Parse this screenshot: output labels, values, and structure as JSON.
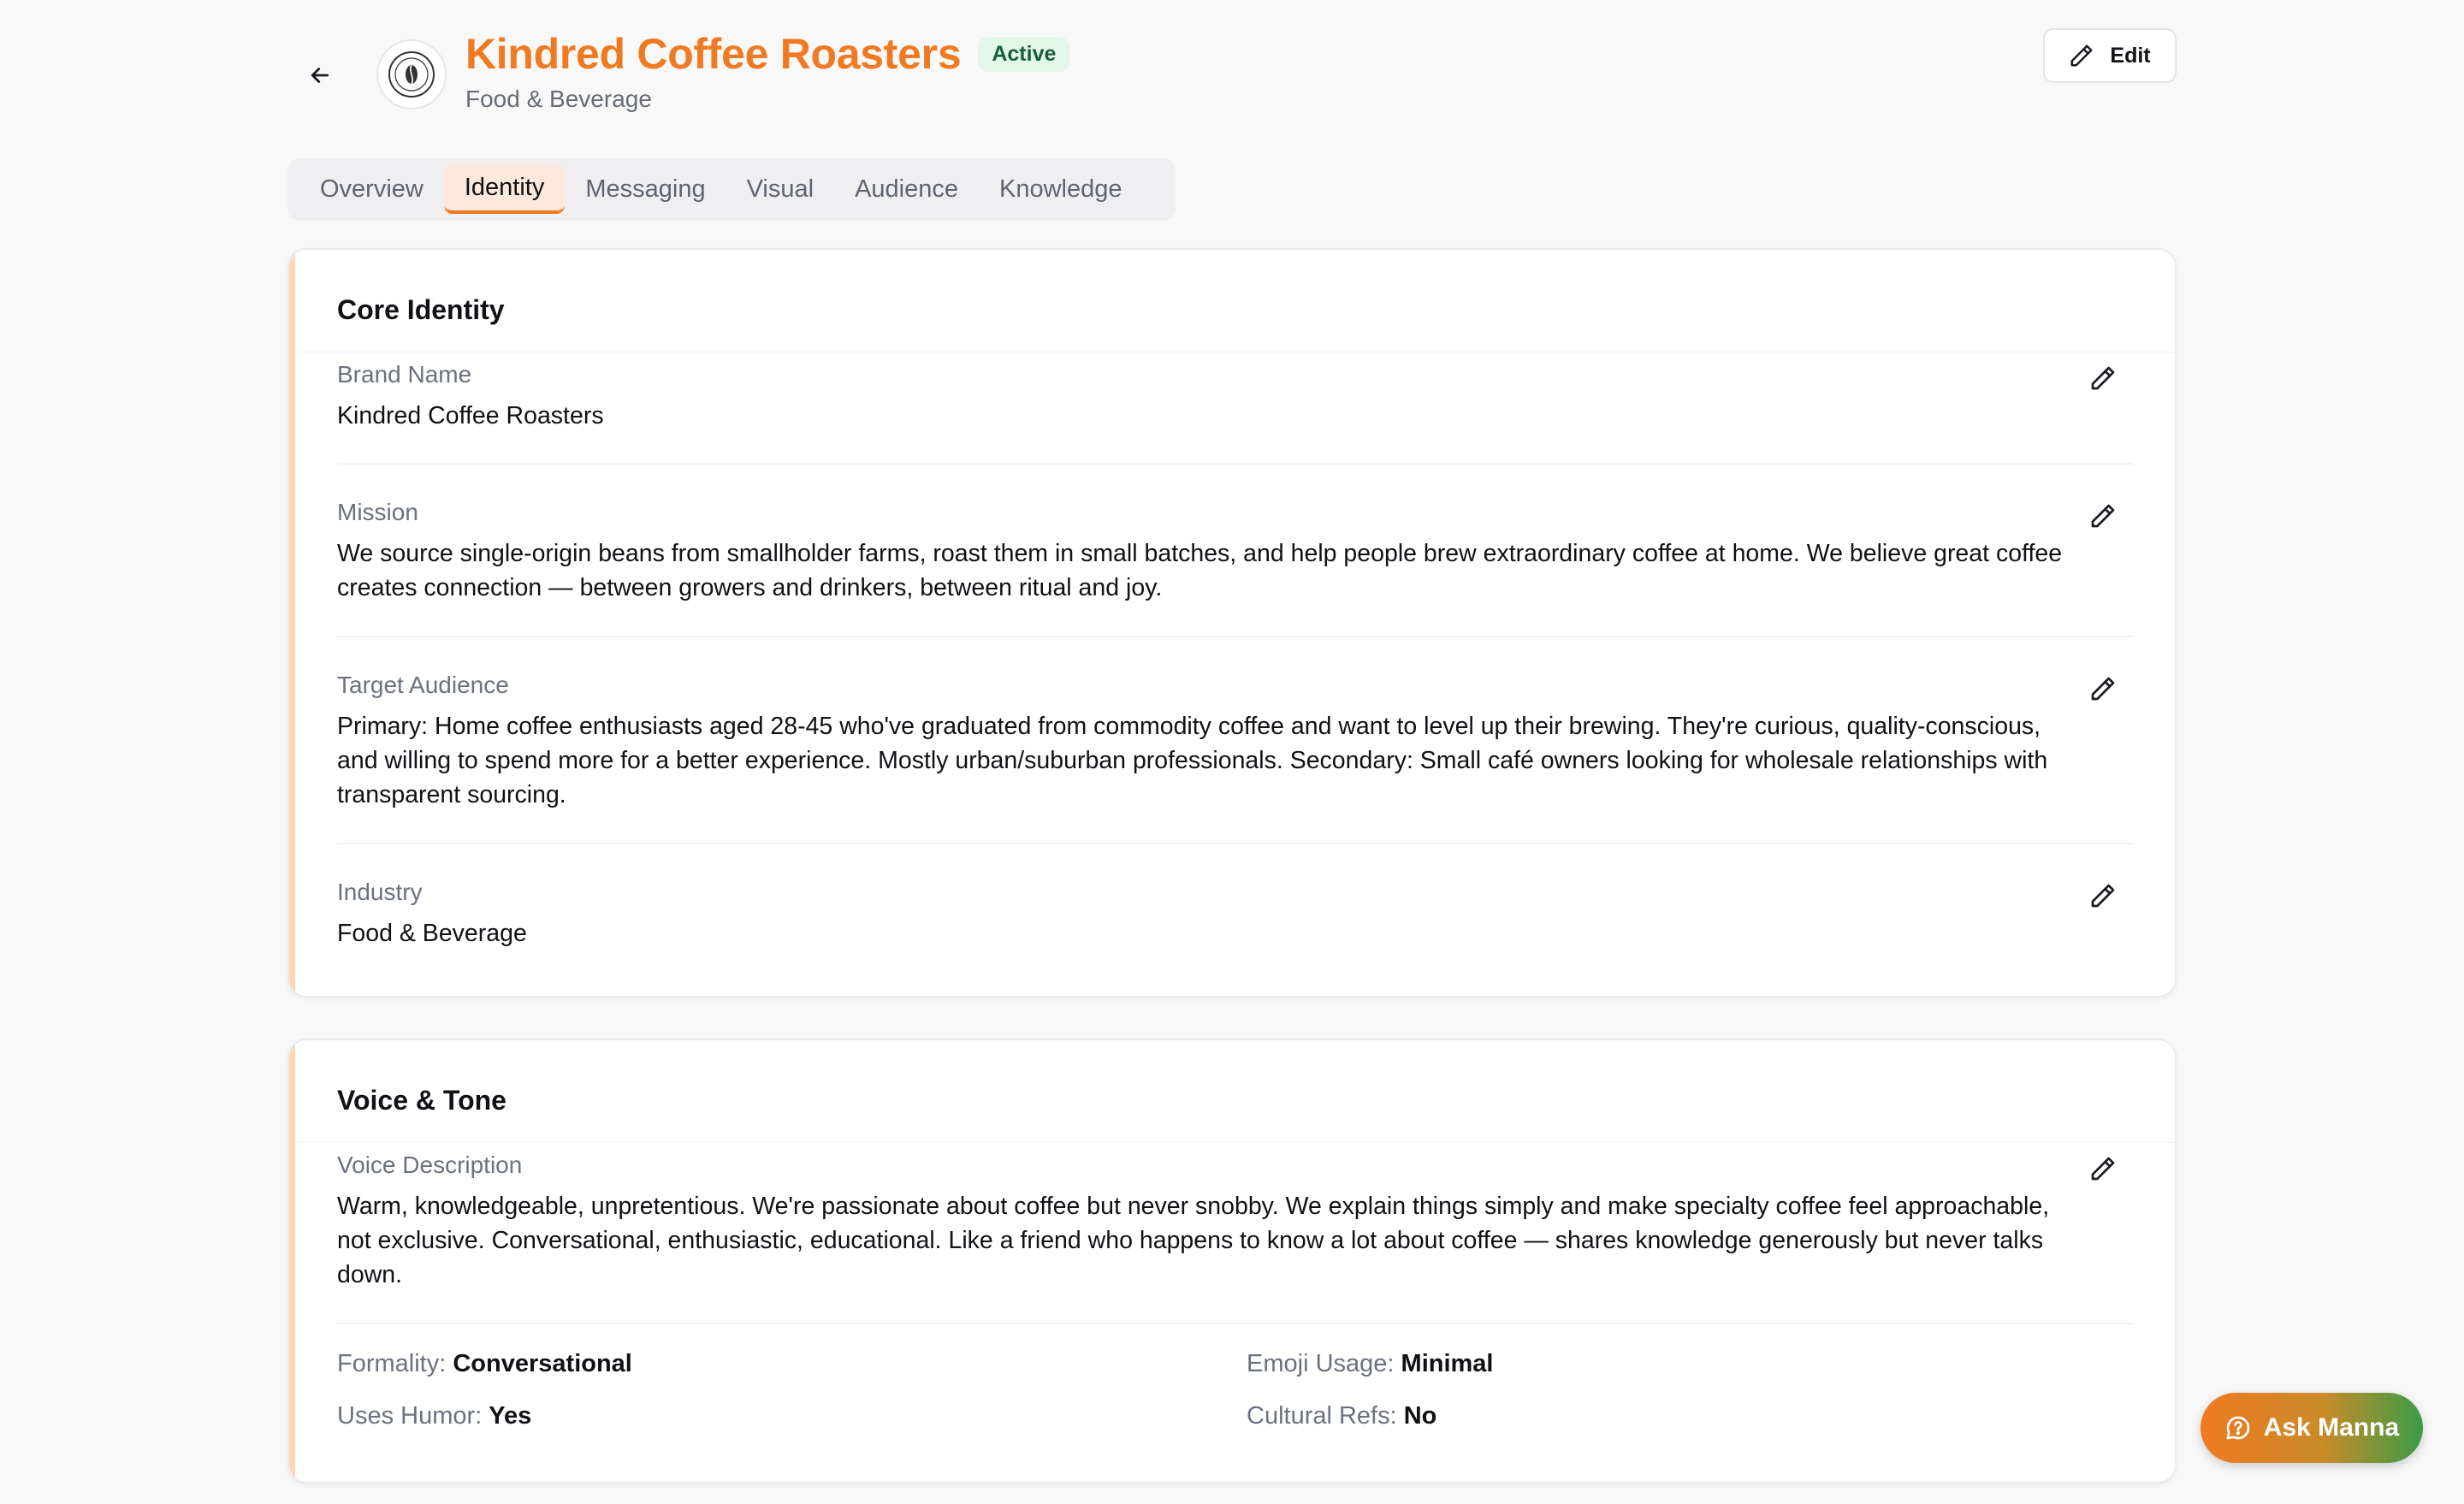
{
  "header": {
    "brand_title": "Kindred Coffee Roasters",
    "status": "Active",
    "subtitle": "Food & Beverage",
    "edit_label": "Edit"
  },
  "tabs": [
    {
      "label": "Overview"
    },
    {
      "label": "Identity"
    },
    {
      "label": "Messaging"
    },
    {
      "label": "Visual"
    },
    {
      "label": "Audience"
    },
    {
      "label": "Knowledge"
    }
  ],
  "active_tab": "Identity",
  "core_identity": {
    "title": "Core Identity",
    "fields": [
      {
        "label": "Brand Name",
        "value": "Kindred Coffee Roasters"
      },
      {
        "label": "Mission",
        "value": "We source single-origin beans from smallholder farms, roast them in small batches, and help people brew extraordinary coffee at home. We believe great coffee creates connection — between growers and drinkers, between ritual and joy."
      },
      {
        "label": "Target Audience",
        "value": "Primary: Home coffee enthusiasts aged 28-45 who've graduated from commodity coffee and want to level up their brewing. They're curious, quality-conscious, and willing to spend more for a better experience. Mostly urban/suburban professionals. Secondary: Small café owners looking for wholesale relationships with transparent sourcing."
      },
      {
        "label": "Industry",
        "value": "Food & Beverage"
      }
    ]
  },
  "voice_tone": {
    "title": "Voice & Tone",
    "voice_label": "Voice Description",
    "voice_value": "Warm, knowledgeable, unpretentious. We're passionate about coffee but never snobby. We explain things simply and make specialty coffee feel approachable, not exclusive. Conversational, enthusiastic, educational. Like a friend who happens to know a lot about coffee — shares knowledge generously but never talks down.",
    "attributes": {
      "formality_label": "Formality:",
      "formality": "Conversational",
      "emoji_label": "Emoji Usage:",
      "emoji": "Minimal",
      "humor_label": "Uses Humor:",
      "humor": "Yes",
      "cultural_label": "Cultural Refs:",
      "cultural": "No"
    }
  },
  "assistant": {
    "label": "Ask Manna"
  },
  "colors": {
    "brand": "#f07a21",
    "active_badge_bg": "#e3f6ea",
    "card_accent": "#fbd7b6"
  }
}
